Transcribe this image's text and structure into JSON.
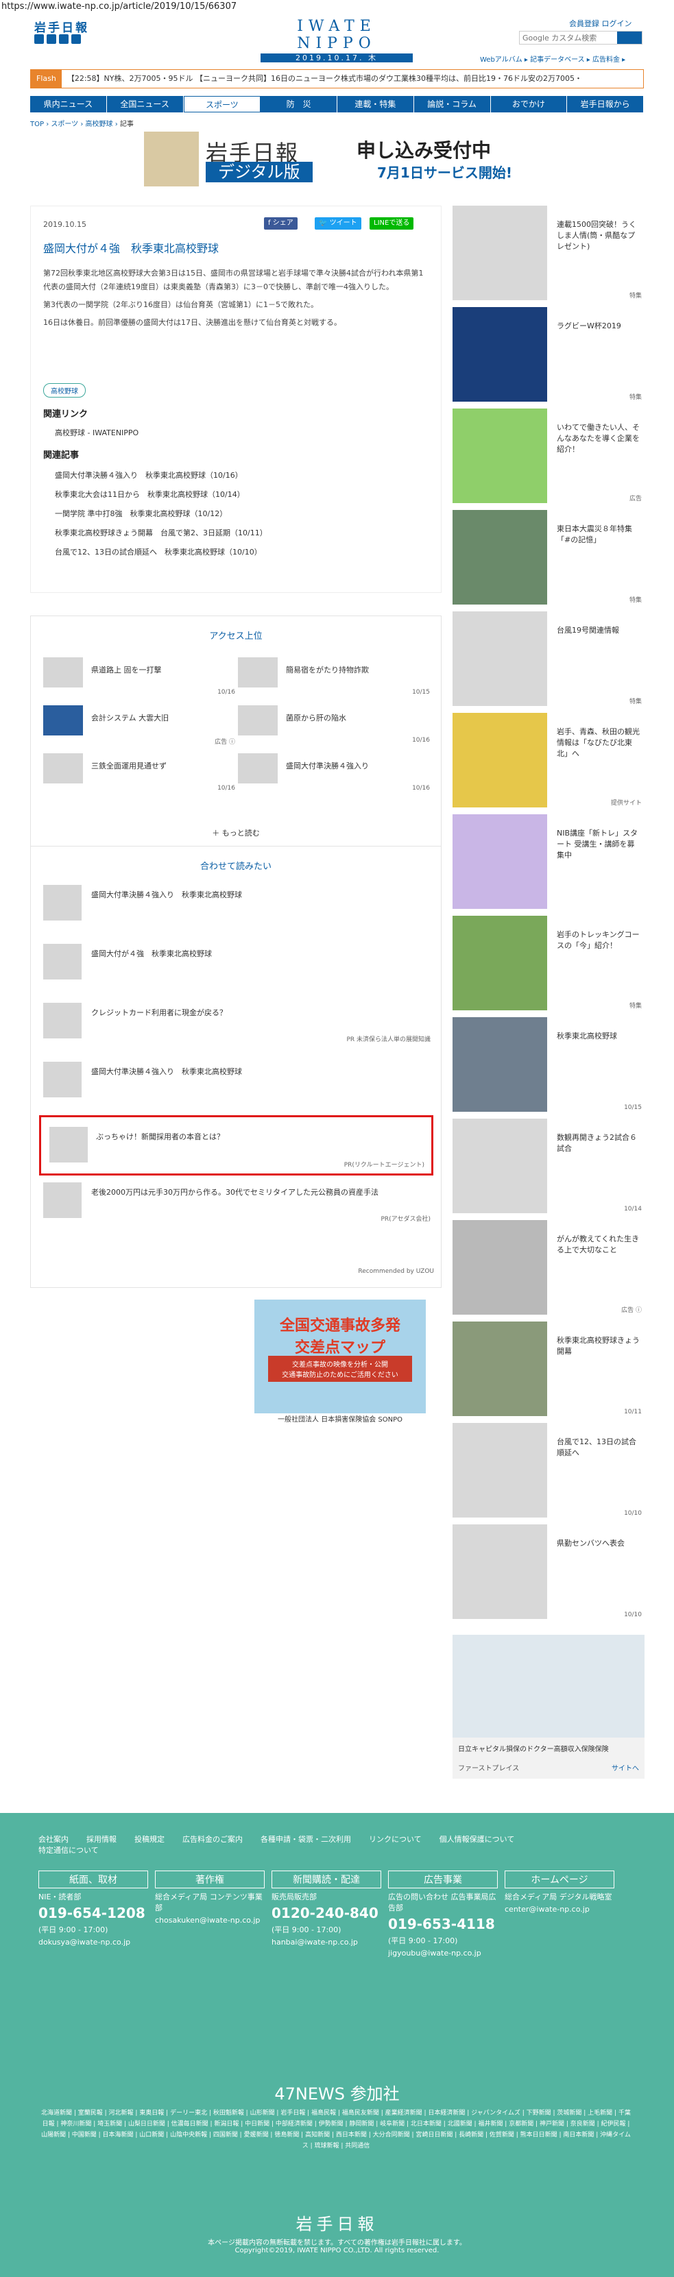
{
  "url": "https://www.iwate-np.co.jp/article/2019/10/15/66307",
  "header": {
    "logo": "岩手日報",
    "brand": "IWATE NIPPO",
    "date": "2019.10.17. 木",
    "links": "会員登録  ログイン",
    "search_placeholder": "Google カスタム検索",
    "sublinks": "Webアルバム ▸  記事データベース ▸  広告料金 ▸"
  },
  "flash": {
    "tag": "Flash",
    "text": "【22:58】NY株、2万7005・95ドル  【ニューヨーク共同】16日のニューヨーク株式市場のダウ工業株30種平均は、前日比19・76ドル安の2万7005・"
  },
  "nav": [
    "県内ニュース",
    "全国ニュース",
    "スポーツ",
    "防　災",
    "連載・特集",
    "論説・コラム",
    "おでかけ",
    "岩手日報から"
  ],
  "crumbs": {
    "items": [
      "TOP",
      "スポーツ",
      "高校野球"
    ],
    "current": "記事"
  },
  "banner": {
    "left": "岩手日報",
    "sub": "デジタル版",
    "right1": "申し込み受付中",
    "right2": "7月1日サービス開始!"
  },
  "article": {
    "date": "2019.10.15",
    "share": [
      "f シェア",
      "🐦 ツイート",
      "LINEで送る"
    ],
    "title": "盛岡大付が４強　秋季東北高校野球",
    "body": [
      "第72回秋季東北地区高校野球大会第3日は15日、盛岡市の県営球場と岩手球場で準々決勝4試合が行われ本県第1代表の盛岡大付（2年連続19度目）は東奥義塾（青森第3）に3－0で快勝し、準創で唯一4強入りした。",
      "第3代表の一関学院（2年ぶり16度目）は仙台育英（宮城第1）に1－5で敗れた。",
      "16日は休養日。前回準優勝の盛岡大付は17日、決勝進出を懸けて仙台育英と対戦する。"
    ],
    "tag": "高校野球",
    "links_h": "関連リンク",
    "link": "高校野球 - IWATENIPPO",
    "related_h": "関連記事",
    "related": [
      "盛岡大付準決勝４強入り　秋季東北高校野球（10/16）",
      "秋季東北大会は11日から　秋季東北高校野球（10/14）",
      "一関学院 準中打8強　秋季東北高校野球（10/12）",
      "秋季東北高校野球きょう開幕　台風で第2、3日延期（10/11）",
      "台風で12、13日の試合順延へ　秋季東北高校野球（10/10）"
    ]
  },
  "access": {
    "title": "アクセス上位",
    "items": [
      {
        "t": "県道路上 固を一打撃",
        "d": "10/16"
      },
      {
        "t": "簡易宿をがたり持物詐欺",
        "d": "10/15"
      },
      {
        "t": "会計システム 大雲大旧",
        "d": "広告 ⓘ"
      },
      {
        "t": "菌原から肝の陥水",
        "d": "10/16"
      },
      {
        "t": "三鉄全面運用見通せず",
        "d": "10/16"
      },
      {
        "t": "盛岡大付準決勝４強入り",
        "d": "10/16"
      }
    ],
    "more": "＋ もっと読む"
  },
  "rec": {
    "title": "合わせて読みたい",
    "items": [
      {
        "t": "盛岡大付準決勝４強入り　秋季東北高校野球",
        "pr": ""
      },
      {
        "t": "盛岡大付が４強　秋季東北高校野球",
        "pr": ""
      },
      {
        "t": "クレジットカード利用者に現金が戻る？",
        "pr": "PR 未済保ら法人単の展開知識"
      },
      {
        "t": "盛岡大付準決勝４強入り　秋季東北高校野球",
        "pr": ""
      },
      {
        "t": "ぶっちゃけ！新聞採用者の本音とは？",
        "pr": "PR(リクルートエージェント)"
      },
      {
        "t": "老後2000万円は元手30万円から作る。30代でセミリタイアした元公務員の資産手法",
        "pr": "PR(アセダス会社)"
      }
    ],
    "foot": "Recommended by UZOU"
  },
  "insure": {
    "t1": "全国交通事故多発\n交差点マップ",
    "t2": "交差点事故の映像を分析・公開\n交通事故防止のためにご活用ください",
    "t3": "一般社団法人 日本損害保険協会   SONPO"
  },
  "side": [
    {
      "t": "連載1500回突破！うくしま人情(筒・県酷なプレゼント)",
      "d": "特集"
    },
    {
      "t": "ラグビーW杯2019",
      "d": "特集"
    },
    {
      "t": "いわてで働きたい人、そんなあなたを導く企業を紹介！",
      "d": "広告"
    },
    {
      "t": "東日本大震災８年特集「#の記憶」",
      "d": "特集"
    },
    {
      "t": "台風19号関連情報",
      "d": "特集"
    },
    {
      "t": "岩手、青森、秋田の観光情報は「なびたび北東北」へ",
      "d": "提供サイト"
    },
    {
      "t": "NIB講座「新トレ」スタート 受講生・講師を募集中",
      "d": ""
    },
    {
      "t": "岩手のトレッキングコースの「今」紹介！",
      "d": "特集"
    },
    {
      "t": "秋季東北高校野球",
      "d": "10/15"
    },
    {
      "t": "数観再開きょう2試合６試合",
      "d": "10/14"
    },
    {
      "t": "がんが教えてくれた生きる上で大切なこと",
      "d": "広告 ⓘ"
    },
    {
      "t": "秋季東北高校野球きょう開幕",
      "d": "10/11"
    },
    {
      "t": "台風で12、13日の試合順延へ",
      "d": "10/10"
    },
    {
      "t": "県勤センバツへ表会",
      "d": "10/10"
    }
  ],
  "side_ad": {
    "t": "日立キャピタル損保のドクター高額収入保険保険",
    "f": "ファーストプレイス",
    "g": "サイトへ"
  },
  "footer": {
    "links": [
      "会社案内",
      "採用情報",
      "投稿規定",
      "広告料金のご案内",
      "各種申請・袋票・二次利用",
      "リンクについて",
      "個人情報保護について",
      "特定通信について"
    ],
    "cols": [
      {
        "h": "紙面、取材",
        "l": "NIE・読者部",
        "tel": "019-654-1208",
        "h2": "(平日 9:00 - 17:00)",
        "m": "dokusya@iwate-np.co.jp"
      },
      {
        "h": "著作権",
        "l": "総合メディア局 コンテンツ事業部",
        "tel": "",
        "h2": "",
        "m": "chosakuken@iwate-np.co.jp"
      },
      {
        "h": "新聞購読・配達",
        "l": "販売局販売部",
        "tel": "0120-240-840",
        "h2": "(平日 9:00 - 17:00)",
        "m": "hanbai@iwate-np.co.jp"
      },
      {
        "h": "広告事業",
        "l": "広告の問い合わせ 広告事業局広告部",
        "tel": "019-653-4118",
        "h2": "(平日 9:00 - 17:00)",
        "m": "jigyoubu@iwate-np.co.jp"
      },
      {
        "h": "ホームページ",
        "l": "総合メディア局 デジタル戦略室",
        "tel": "",
        "h2": "",
        "m": "center@iwate-np.co.jp"
      }
    ],
    "p47": "47NEWS 参加社",
    "p47list": "北海道新聞 | 室蘭民報 | 河北新報 | 東奥日報 | デーリー東北 | 秋田魁新報 | 山形新聞 | 岩手日報 | 福島民報 | 福島民友新聞 | 産業経済新聞 | 日本経済新聞 | ジャパンタイムズ | 下野新聞 | 茨城新聞 | 上毛新聞 | 千葉日報 | 神奈川新聞 | 埼玉新聞 | 山梨日日新聞 | 信濃毎日新聞 | 新潟日報 | 中日新聞 | 中部経済新聞 | 伊勢新聞 | 静岡新聞 | 岐阜新聞 | 北日本新聞 | 北國新聞 | 福井新聞 | 京都新聞 | 神戸新聞 | 奈良新聞 | 紀伊民報 | 山陽新聞 | 中国新聞 | 日本海新聞 | 山口新聞 | 山陰中央新報 | 四国新聞 | 愛媛新聞 | 徳島新聞 | 高知新聞 | 西日本新聞 | 大分合同新聞 | 宮崎日日新聞 | 長崎新聞 | 佐賀新聞 | 熊本日日新聞 | 南日本新聞 | 沖縄タイムス | 琉球新報 | 共同通信",
    "logo": "岩手日報",
    "copy": "本ページ掲載内容の無断転載を禁じます。すべての著作権は岩手日報社に属します。\nCopyright©2019, IWATE NIPPO CO.,LTD. All rights reserved."
  }
}
